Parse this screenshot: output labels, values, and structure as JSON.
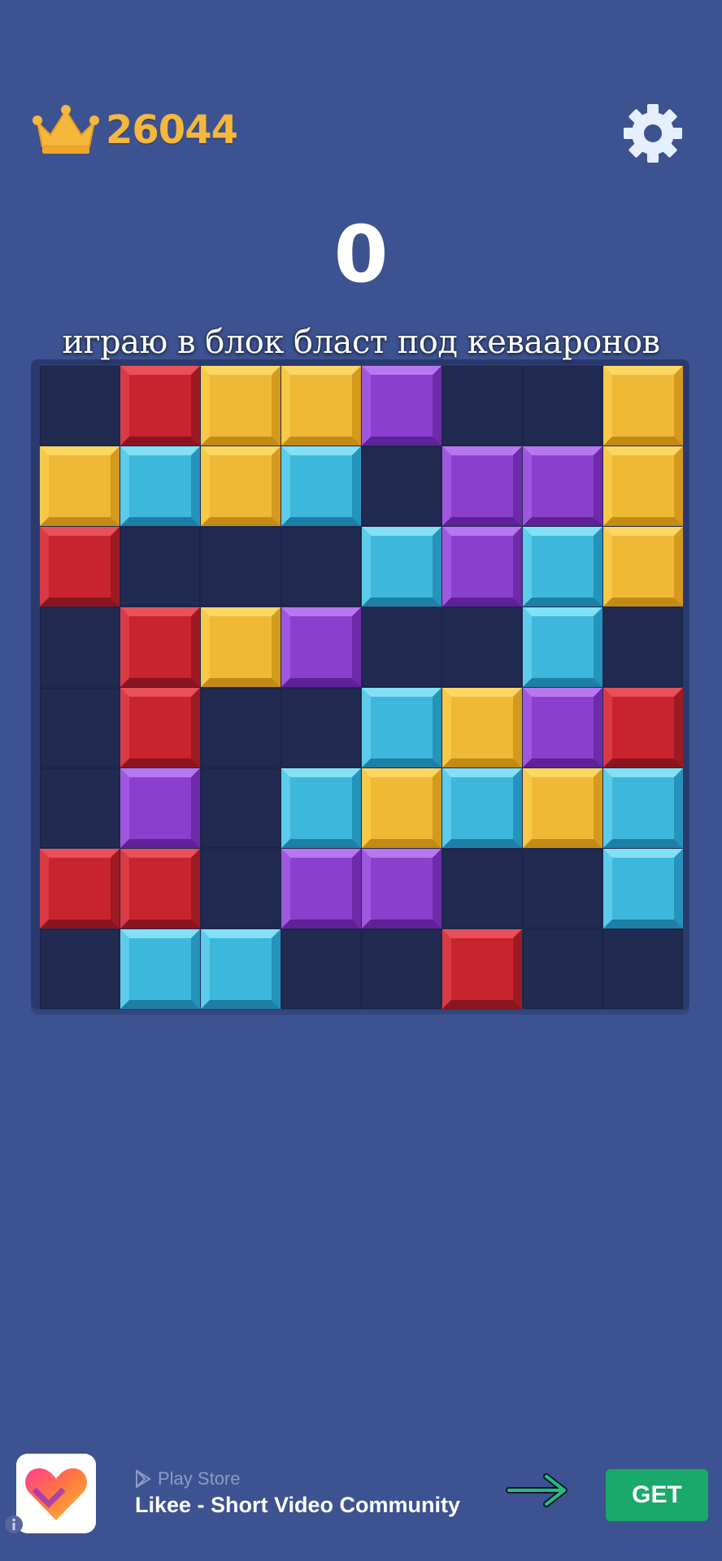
{
  "header": {
    "best_score": "26044",
    "current_score": "0",
    "crown_icon": "crown-icon",
    "settings_icon": "gear-icon"
  },
  "caption": "играю в блок бласт под кевааронов",
  "board": {
    "rows": 8,
    "cols": 8,
    "grid": [
      [
        ".",
        "R",
        "Y",
        "Y",
        "P",
        ".",
        ".",
        "Y"
      ],
      [
        "Y",
        "C",
        "Y",
        "C",
        ".",
        "P",
        "P",
        "Y"
      ],
      [
        "R",
        ".",
        ".",
        ".",
        "C",
        "P",
        "C",
        "Y"
      ],
      [
        ".",
        "R",
        "Y",
        "P",
        ".",
        ".",
        "C",
        "."
      ],
      [
        ".",
        "R",
        ".",
        ".",
        "C",
        "Y",
        "P",
        "R"
      ],
      [
        ".",
        "P",
        ".",
        "C",
        "Y",
        "C",
        "Y",
        "C"
      ],
      [
        "R",
        "R",
        ".",
        "P",
        "P",
        ".",
        ".",
        "C"
      ],
      [
        ".",
        "C",
        "C",
        ".",
        ".",
        "R",
        ".",
        "."
      ]
    ],
    "palette": {
      "R": {
        "name": "red",
        "face": "#c8242f",
        "top": "#e8505a",
        "left": "#d93a44",
        "right": "#9e1a23",
        "bottom": "#8a1520"
      },
      "Y": {
        "name": "yellow",
        "face": "#f0b935",
        "top": "#fad862",
        "left": "#f6c948",
        "right": "#d39a1e",
        "bottom": "#c48a16"
      },
      "C": {
        "name": "cyan",
        "face": "#3eb7dc",
        "top": "#84e0f4",
        "left": "#5cccea",
        "right": "#2593bb",
        "bottom": "#1d7fa6"
      },
      "P": {
        "name": "purple",
        "face": "#8c3fcf",
        "top": "#b877ee",
        "left": "#a057e0",
        "right": "#6e2aa8",
        "bottom": "#5e2196"
      }
    }
  },
  "ad": {
    "app_icon": "likee-heart-icon",
    "store_icon": "play-store-icon",
    "store_label": "Play Store",
    "title": "Likee - Short Video Community",
    "arrow_icon": "arrow-right-icon",
    "cta": "GET",
    "info_icon": "info-icon"
  }
}
